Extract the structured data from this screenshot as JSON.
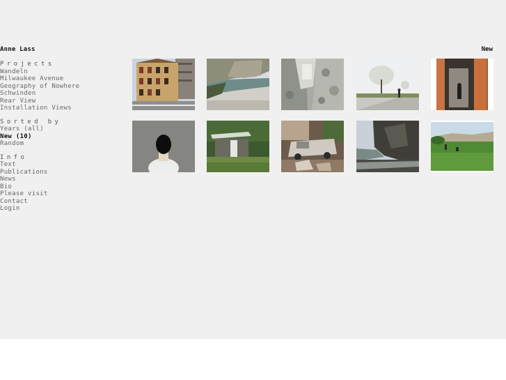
{
  "site": {
    "title": "Anne Lass"
  },
  "sidebar": {
    "projects": {
      "heading": "Projects",
      "items": [
        "Wandeln",
        "Milwaukee Avenue",
        "Geography of Nowhere",
        "Schwinden",
        "Rear View",
        "Installation Views"
      ]
    },
    "sorted": {
      "heading": "Sorted by",
      "items": [
        "Years (all)",
        "New (10)",
        "Random"
      ],
      "active": "New (10)"
    },
    "info": {
      "heading": "Info",
      "items": [
        "Text",
        "Publications",
        "News",
        "Bio",
        "Please visit",
        "Contact",
        "Login"
      ]
    }
  },
  "gallery": {
    "filter_label": "New",
    "thumbnails": [
      {
        "icon": "photo-building"
      },
      {
        "icon": "photo-coast-road"
      },
      {
        "icon": "photo-rock-facade"
      },
      {
        "icon": "photo-blossom-tree"
      },
      {
        "icon": "photo-doorway"
      },
      {
        "icon": "photo-masked-figure"
      },
      {
        "icon": "photo-shed-forest"
      },
      {
        "icon": "photo-wrecked-car"
      },
      {
        "icon": "photo-rock-cliff"
      },
      {
        "icon": "photo-green-field"
      }
    ]
  }
}
